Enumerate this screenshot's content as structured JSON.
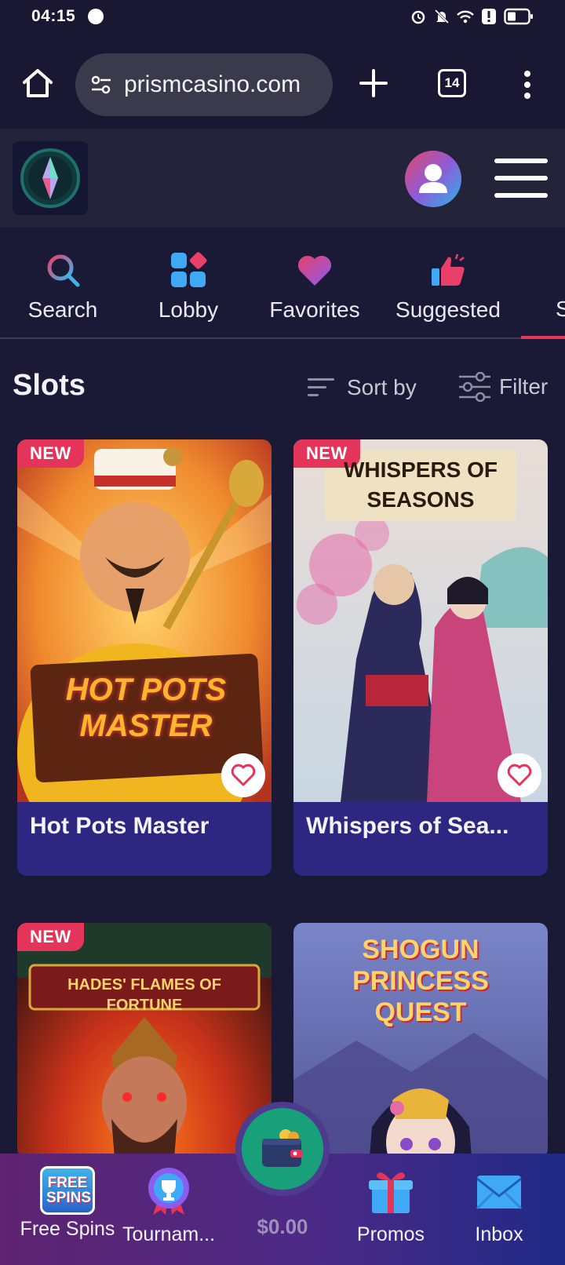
{
  "status_bar": {
    "time": "04:15"
  },
  "browser": {
    "url": "prismcasino.com",
    "tab_count": "14"
  },
  "categories": [
    {
      "label": "Search",
      "icon": "search-icon"
    },
    {
      "label": "Lobby",
      "icon": "grid-icon"
    },
    {
      "label": "Favorites",
      "icon": "heart-icon"
    },
    {
      "label": "Suggested",
      "icon": "thumbs-up-icon"
    }
  ],
  "category_partial": "S",
  "section": {
    "title": "Slots",
    "sort_label": "Sort by",
    "filter_label": "Filter"
  },
  "games": [
    {
      "title": "Hot Pots Master",
      "badge": "NEW",
      "art_text": "HOT POTS MASTER"
    },
    {
      "title": "Whispers of Sea...",
      "badge": "NEW",
      "art_text": "WHISPERS OF SEASONS"
    },
    {
      "title": "",
      "badge": "NEW",
      "art_text": "HADES' FLAMES OF FORTUNE"
    },
    {
      "title": "",
      "badge": "",
      "art_text": "SHOGUN PRINCESS QUEST"
    }
  ],
  "bottom_nav": {
    "free_spins": "Free Spins",
    "free_spins_icon_text": "FREE SPINS",
    "tournaments": "Tournam...",
    "balance": "$0.00",
    "promos": "Promos",
    "inbox": "Inbox"
  },
  "colors": {
    "background": "#1b1a36",
    "card": "#2d2781",
    "badge": "#e5345a",
    "accent_red": "#e23a52",
    "wallet": "#18a07b"
  }
}
